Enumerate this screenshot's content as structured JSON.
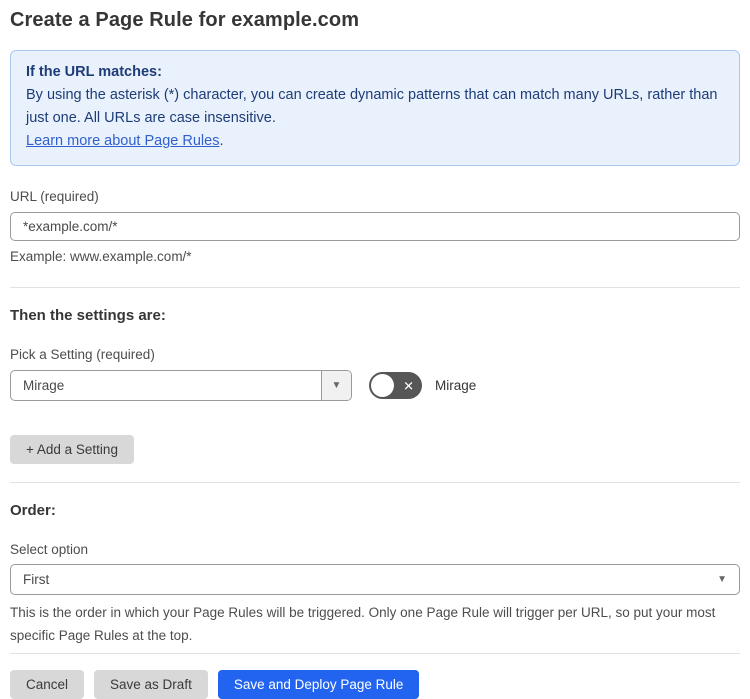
{
  "page": {
    "title": "Create a Page Rule for example.com"
  },
  "info_box": {
    "heading": "If the URL matches:",
    "body": "By using the asterisk (*) character, you can create dynamic patterns that can match many URLs, rather than just one. All URLs are case insensitive.",
    "link_label": "Learn more about Page Rules",
    "link_suffix": "."
  },
  "url_field": {
    "label": "URL (required)",
    "value": "*example.com/*",
    "helper": "Example: www.example.com/*"
  },
  "settings_section": {
    "heading": "Then the settings are:",
    "setting_label": "Pick a Setting (required)",
    "selected_setting": "Mirage",
    "toggle": {
      "label": "Mirage",
      "state": "off",
      "icon": "x-icon",
      "x_glyph": "✕"
    },
    "add_button_label": "+ Add a Setting"
  },
  "order_section": {
    "heading": "Order:",
    "label": "Select option",
    "selected_option": "First",
    "helper": "This is the order in which your Page Rules will be triggered. Only one Page Rule will trigger per URL, so put your most specific Page Rules at the top.",
    "caret_glyph": "▼"
  },
  "footer": {
    "cancel_label": "Cancel",
    "save_draft_label": "Save as Draft",
    "save_deploy_label": "Save and Deploy Page Rule"
  },
  "colors": {
    "accent_blue": "#2264f0",
    "info_bg": "#e9f2fc",
    "info_border": "#a9c9ef",
    "info_text": "#1e3c78",
    "link_blue": "#3060d0",
    "toggle_off_bg": "#565656",
    "button_gray": "#d8d8d8",
    "border_gray": "#9a9a9a",
    "divider_gray": "#e2e2e2"
  }
}
